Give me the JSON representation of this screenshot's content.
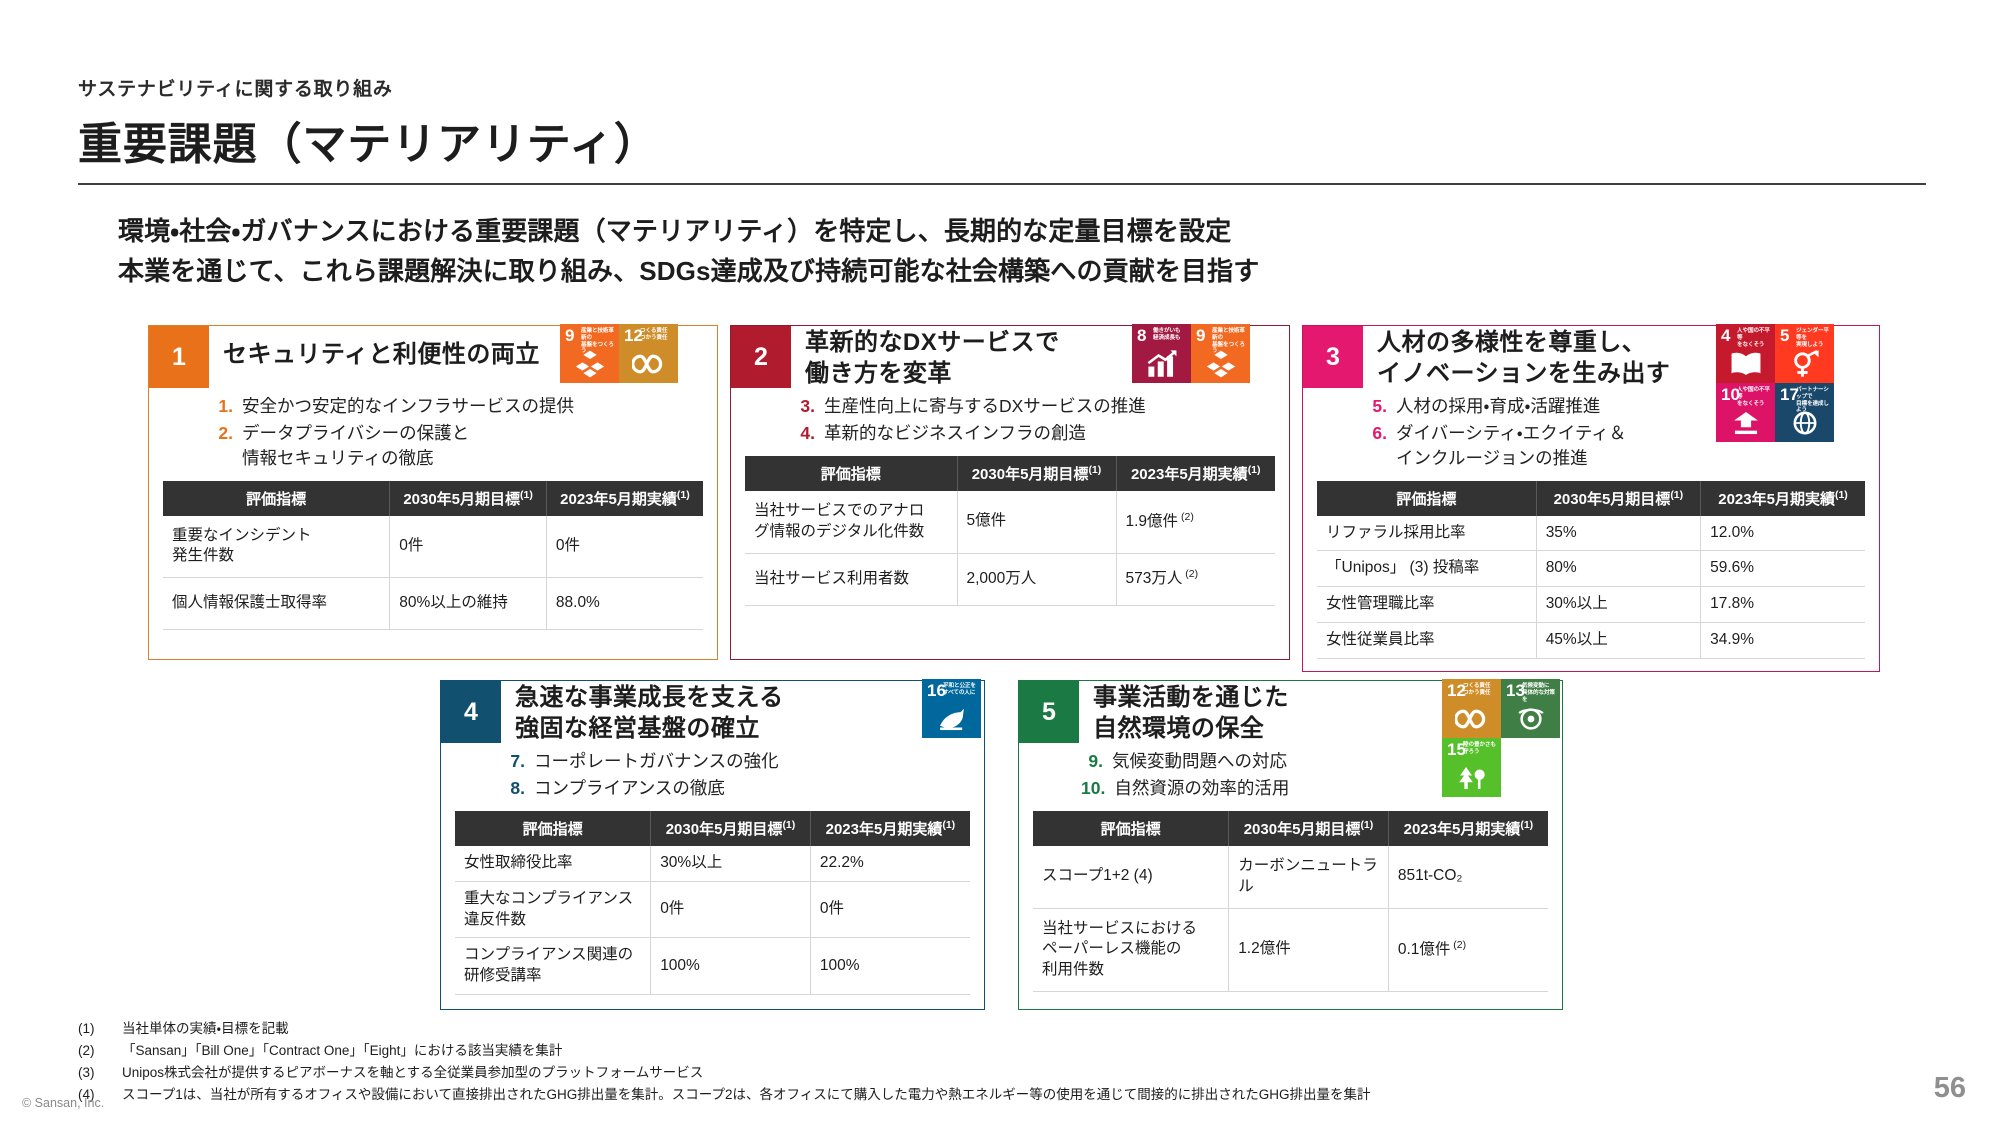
{
  "header": {
    "eyebrow": "サステナビリティに関する取り組み",
    "title": "重要課題（マテリアリティ）"
  },
  "lead": {
    "line1": "環境・社会・ガバナンスにおける重要課題（マテリアリティ）を特定し、長期的な定量目標を設定",
    "line2": "本業を通じて、これら課題解決に取り組み、SDGs達成及び持続可能な社会構築への貢献を目指す"
  },
  "table_headers": {
    "metric": "評価指標",
    "target": "2030年5月期目標",
    "actual": "2023年5月期実績",
    "note1": "(1)"
  },
  "cards": [
    {
      "number": "1",
      "title": "セキュリティと利便性の両立",
      "color": "#e8711a",
      "border": "#d9812c",
      "items": [
        {
          "n": "1.",
          "text": "安全かつ安定的なインフラサービスの提供"
        },
        {
          "n": "2.",
          "text": "データプライバシーの保護と\n情報セキュリティの徹底"
        }
      ],
      "sdgs": [
        {
          "n": "9",
          "label": "産業と技術革新の\n基盤をつくろう",
          "color": "#f26a21",
          "glyph": "cubes"
        },
        {
          "n": "12",
          "label": "つくる責任\nつかう責任",
          "color": "#cf8d2a",
          "glyph": "infinity"
        }
      ],
      "rows": [
        {
          "metric": "重要なインシデント\n発生件数",
          "target": "0件",
          "actual": "0件",
          "actual_note": ""
        },
        {
          "metric": "個人情報保護士取得率",
          "target": "80%以上の維持",
          "actual": "88.0%",
          "actual_note": ""
        }
      ]
    },
    {
      "number": "2",
      "title": "革新的なDXサービスで\n働き方を変革",
      "color": "#b01c2e",
      "border": "#8c1b33",
      "items": [
        {
          "n": "3.",
          "text": "生産性向上に寄与するDXサービスの推進"
        },
        {
          "n": "4.",
          "text": "革新的なビジネスインフラの創造"
        }
      ],
      "sdgs": [
        {
          "n": "8",
          "label": "働きがいも\n経済成長も",
          "color": "#a21942",
          "glyph": "chart"
        },
        {
          "n": "9",
          "label": "産業と技術革新の\n基盤をつくろう",
          "color": "#f26a21",
          "glyph": "cubes"
        }
      ],
      "rows": [
        {
          "metric": "当社サービスでのアナロ\nグ情報のデジタル化件数",
          "target": "5億件",
          "actual": "1.9億件",
          "actual_note": "(2)"
        },
        {
          "metric": "当社サービス利用者数",
          "target": "2,000万人",
          "actual": "573万人",
          "actual_note": "(2)"
        }
      ]
    },
    {
      "number": "3",
      "title": "人材の多様性を尊重し、\nイノベーションを生み出す",
      "color": "#e5186f",
      "border": "#c2185b",
      "items": [
        {
          "n": "5.",
          "text": "人材の採用・育成・活躍推進"
        },
        {
          "n": "6.",
          "text": "ダイバーシティ・エクイティ＆\nインクルージョンの推進"
        }
      ],
      "sdgs": [
        {
          "n": "4",
          "label": "人や国の不平等\nをなくそう",
          "color": "#c5192d",
          "glyph": "book"
        },
        {
          "n": "5",
          "label": "ジェンダー平等を\n実現しよう",
          "color": "#ff3a21",
          "glyph": "gender"
        },
        {
          "n": "10",
          "label": "人や国の不平等\nをなくそう",
          "color": "#dd1367",
          "glyph": "equal"
        },
        {
          "n": "17",
          "label": "パートナーシップで\n目標を達成しよう",
          "color": "#19486a",
          "glyph": "circle"
        }
      ],
      "rows": [
        {
          "metric": "リファラル採用比率",
          "target": "35%",
          "actual": "12.0%",
          "actual_note": ""
        },
        {
          "metric": "「Unipos」 (3) 投稿率",
          "target": "80%",
          "actual": "59.6%",
          "actual_note": ""
        },
        {
          "metric": "女性管理職比率",
          "target": "30%以上",
          "actual": "17.8%",
          "actual_note": ""
        },
        {
          "metric": "女性従業員比率",
          "target": "45%以上",
          "actual": "34.9%",
          "actual_note": ""
        }
      ]
    },
    {
      "number": "4",
      "title": "急速な事業成長を支える\n強固な経営基盤の確立",
      "color": "#12506f",
      "border": "#12506f",
      "items": [
        {
          "n": "7.",
          "text": "コーポレートガバナンスの強化"
        },
        {
          "n": "8.",
          "text": "コンプライアンスの徹底"
        }
      ],
      "sdgs": [
        {
          "n": "16",
          "label": "平和と公正を\nすべての人に",
          "color": "#00689d",
          "glyph": "dove"
        }
      ],
      "rows": [
        {
          "metric": "女性取締役比率",
          "target": "30%以上",
          "actual": "22.2%",
          "actual_note": ""
        },
        {
          "metric": "重大なコンプライアンス\n違反件数",
          "target": "0件",
          "actual": "0件",
          "actual_note": ""
        },
        {
          "metric": "コンプライアンス関連の\n研修受講率",
          "target": "100%",
          "actual": "100%",
          "actual_note": ""
        }
      ]
    },
    {
      "number": "5",
      "title": "事業活動を通じた\n自然環境の保全",
      "color": "#1b7a43",
      "border": "#1b7a43",
      "items": [
        {
          "n": "9.",
          "text": "気候変動問題への対応"
        },
        {
          "n": "10.",
          "text": "自然資源の効率的活用"
        }
      ],
      "sdgs": [
        {
          "n": "12",
          "label": "つくる責任\nつかう責任",
          "color": "#cf8d2a",
          "glyph": "infinity"
        },
        {
          "n": "13",
          "label": "気候変動に\n具体的な対策を",
          "color": "#3f7e44",
          "glyph": "eye"
        },
        {
          "n": "15",
          "label": "陸の豊かさも\n守ろう",
          "color": "#56c02b",
          "glyph": "tree"
        }
      ],
      "rows": [
        {
          "metric": "スコープ1+2 (4)",
          "target": "カーボンニュートラル",
          "actual": "851t-CO₂",
          "actual_note": ""
        },
        {
          "metric": "当社サービスにおける\nペーパーレス機能の\n利用件数",
          "target": "1.2億件",
          "actual": "0.1億件",
          "actual_note": "(2)"
        }
      ]
    }
  ],
  "notes": [
    {
      "mark": "(1)",
      "text": "当社単体の実績・目標を記載"
    },
    {
      "mark": "(2)",
      "text": "「Sansan」「Bill One」「Contract One」「Eight」における該当実績を集計"
    },
    {
      "mark": "(3)",
      "text": "Unipos株式会社が提供するピアボーナスを軸とする全従業員参加型のプラットフォームサービス"
    },
    {
      "mark": "(4)",
      "text": "スコープ1は、当社が所有するオフィスや設備において直接排出されたGHG排出量を集計。スコープ2は、各オフィスにて購入した電力や熱エネルギー等の使用を通じて間接的に排出されたGHG排出量を集計"
    }
  ],
  "footer": {
    "copyright": "© Sansan, Inc.",
    "page": "56"
  }
}
